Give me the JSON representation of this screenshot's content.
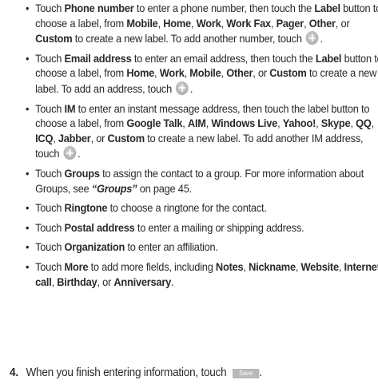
{
  "bullets": {
    "phone": {
      "t1": "Touch ",
      "k1": "Phone number",
      "t2": " to enter a phone number, then touch the ",
      "k2": "Label",
      "t3": " button to choose a label, from ",
      "k3": "Mobile",
      "t4": ", ",
      "k4": "Home",
      "t5": ", ",
      "k5": "Work",
      "t6": ", ",
      "k6": "Work Fax",
      "t7": ", ",
      "k7": "Pager",
      "t8": ", ",
      "k8": "Other",
      "t9": ", or ",
      "k9": "Custom",
      "t10": " to create a new label. To add another number, touch ",
      "t11": "."
    },
    "email": {
      "t1": "Touch ",
      "k1": "Email address",
      "t2": " to enter an email address, then touch the ",
      "k2": "Label",
      "t3": " button to choose a label, from ",
      "k3": "Home",
      "t4": ", ",
      "k4": "Work",
      "t5": ", ",
      "k5": "Mobile",
      "t6": ", ",
      "k6": "Other",
      "t7": ", or ",
      "k7": "Custom",
      "t8": " to create a new label. To add an address, touch ",
      "t9": "."
    },
    "im": {
      "t1": "Touch ",
      "k1": "IM",
      "t2": " to enter an instant message address, then touch the label button to choose a label, from ",
      "k2": "Google Talk",
      "t3": ", ",
      "k3": "AIM",
      "t4": ", ",
      "k4": "Windows Live",
      "t5": ", ",
      "k5": "Yahoo!",
      "t6": ", ",
      "k6": "Skype",
      "t7": ", ",
      "k7": "QQ",
      "t8": ", ",
      "k8": "ICQ",
      "t9": ", ",
      "k9": "Jabber",
      "t10": ", or ",
      "k10": "Custom",
      "t11": " to create a new label. To add another IM address, touch ",
      "t12": "."
    },
    "groups": {
      "t1": "Touch ",
      "k1": "Groups",
      "t2": " to assign the contact to a group. For more information about Groups, see ",
      "ref": "“Groups”",
      "t3": " on page 45."
    },
    "ringtone": {
      "t1": "Touch ",
      "k1": "Ringtone",
      "t2": " to choose a ringtone for the contact."
    },
    "postal": {
      "t1": "Touch ",
      "k1": "Postal address",
      "t2": " to enter a mailing or shipping address."
    },
    "organization": {
      "t1": "Touch ",
      "k1": "Organization",
      "t2": " to enter an affiliation."
    },
    "more": {
      "t1": "Touch ",
      "k1": "More",
      "t2": " to add more fields, including ",
      "k2": "Notes",
      "t3": ", ",
      "k3": "Nickname",
      "t4": ", ",
      "k4": "Website",
      "t5": ", ",
      "k5": "Internet call",
      "t6": ", ",
      "k6": "Birthday",
      "t7": ", or ",
      "k7": "Anniversary",
      "t8": "."
    }
  },
  "step4": {
    "number": "4.",
    "text": "When you finish entering information, touch ",
    "button_label": "Save",
    "end": "."
  },
  "icons": {
    "add": "plus-circle-icon"
  },
  "colors": {
    "text": "#2a2a2a",
    "icon": "#b4b4b4",
    "button": "#b9b9b9"
  }
}
